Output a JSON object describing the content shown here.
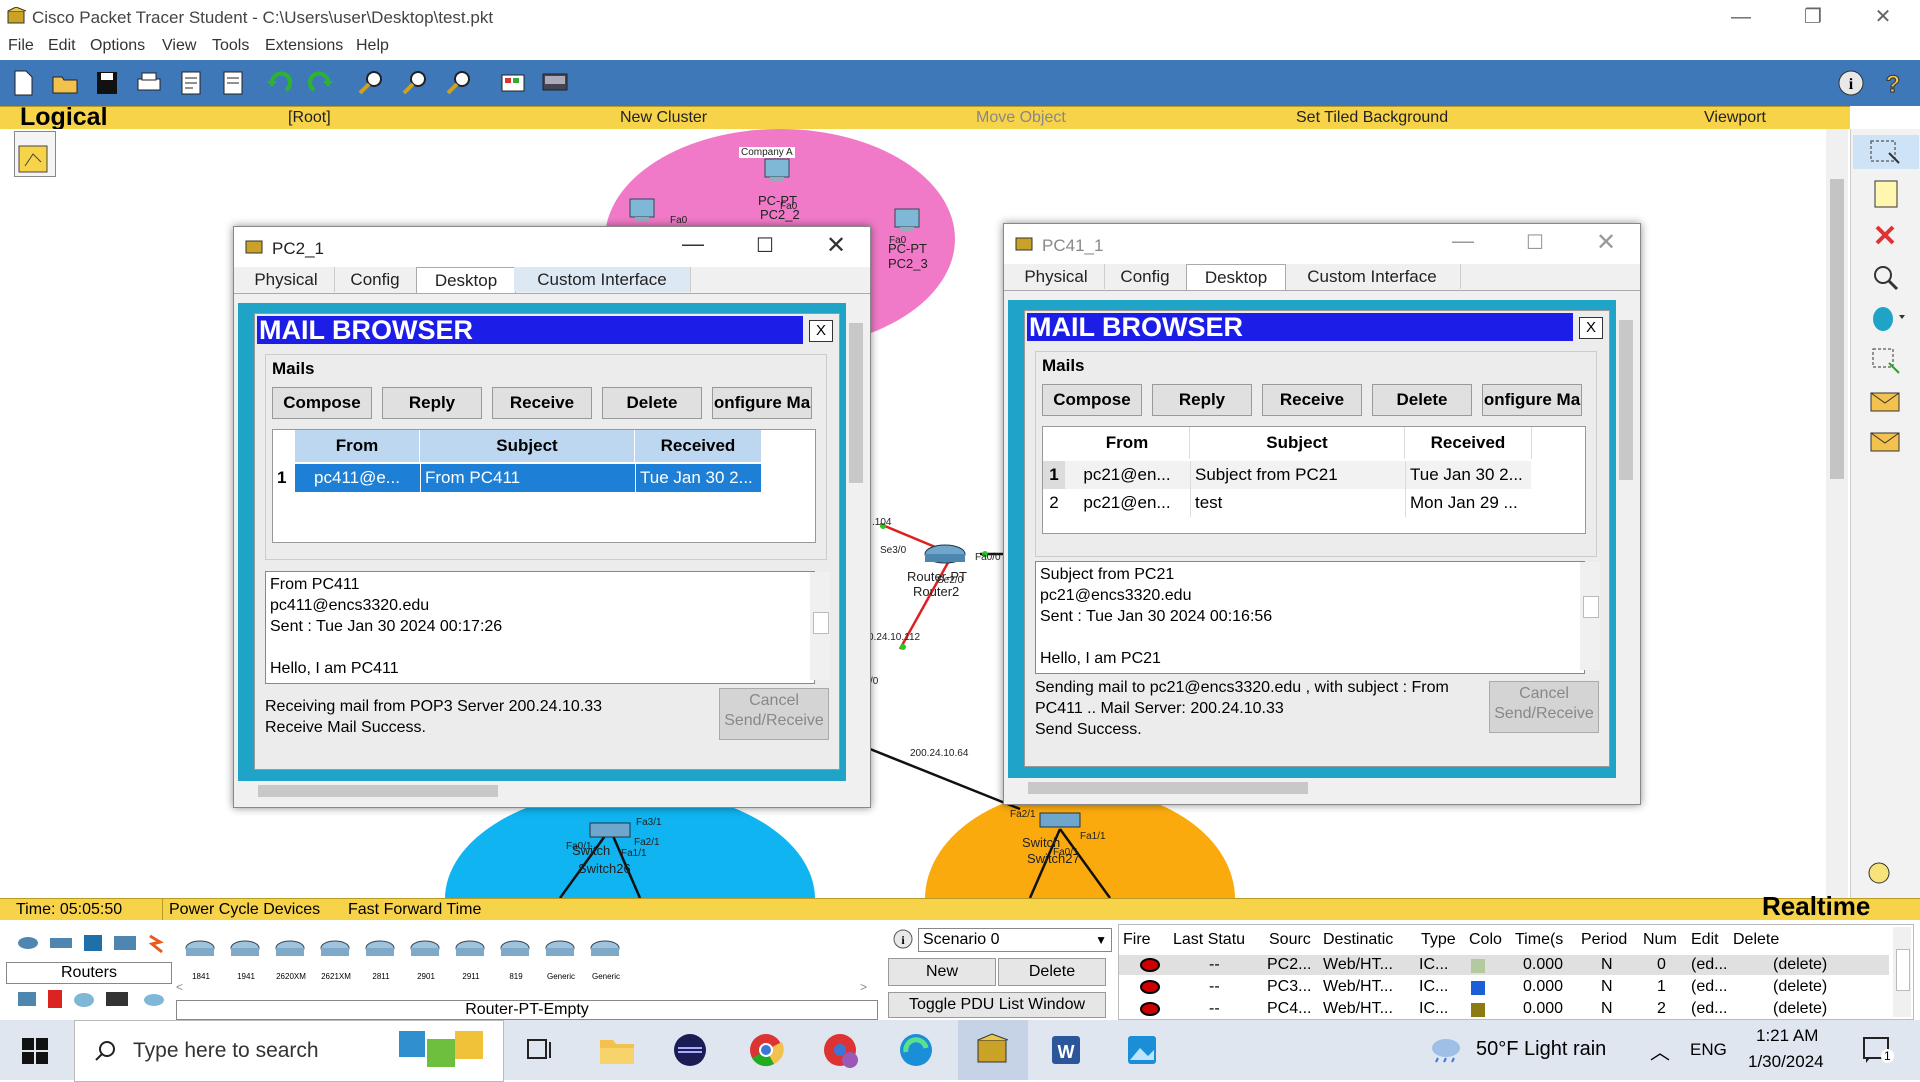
{
  "app": {
    "title": "Cisco Packet Tracer Student - C:\\Users\\user\\Desktop\\test.pkt",
    "menu": [
      "File",
      "Edit",
      "Options",
      "View",
      "Tools",
      "Extensions",
      "Help"
    ]
  },
  "workspace_bar": {
    "logical": "Logical",
    "root": "[Root]",
    "new_cluster": "New Cluster",
    "move_object": "Move Object",
    "set_tiled_bg": "Set Tiled Background",
    "viewport": "Viewport"
  },
  "network": {
    "labels": {
      "company_a": "Company A",
      "pc_pt_1": "PC-PT",
      "pc2_2": "PC2_2",
      "pc_pt_2": "PC-PT",
      "pc2_3": "PC2_3",
      "fa0_a": "Fa0",
      "fa0_b": "Fa0",
      "fa0_c": "Fa0",
      "ip_104": ".104",
      "se3_0": "Se3/0",
      "se2_0": "Se2/0",
      "fa0_0": "Fa0/0",
      "router_pt": "Router-PT",
      "router2": "Router2",
      "ip_112": "0.24.10.112",
      "slash0": "/0",
      "ip_64": "200.24.10.64",
      "fa3_1": "Fa3/1",
      "fa2_1_a": "Fa2/1",
      "fa1_1_a": "Fa1/1",
      "fa0_1_a": "Fa0/1",
      "switch26": "Switch26",
      "switch_a": "Switch",
      "fa2_1_b": "Fa2/1",
      "fa1_1_b": "Fa1/1",
      "fa0_1_b": "Fa0/1",
      "switch_b": "Switch",
      "switch27": "Switch27"
    }
  },
  "win1": {
    "title": "PC2_1",
    "tabs": [
      "Physical",
      "Config",
      "Desktop",
      "Custom Interface"
    ],
    "mail_title": "MAIL BROWSER",
    "close": "X",
    "mails_label": "Mails",
    "buttons": [
      "Compose",
      "Reply",
      "Receive",
      "Delete",
      "onfigure Ma"
    ],
    "columns": [
      "From",
      "Subject",
      "Received"
    ],
    "rows": [
      {
        "n": "1",
        "from": "pc411@e...",
        "subject": "From PC411",
        "received": "Tue Jan 30 2..."
      }
    ],
    "message": [
      "From PC411",
      "pc411@encs3320.edu",
      "Sent : Tue Jan 30 2024 00:17:26",
      "",
      "Hello, I am PC411"
    ],
    "status": [
      "Receiving mail from POP3 Server 200.24.10.33",
      "Receive Mail Success."
    ],
    "cancel": [
      "Cancel",
      "Send/Receive"
    ]
  },
  "win2": {
    "title": "PC41_1",
    "tabs": [
      "Physical",
      "Config",
      "Desktop",
      "Custom Interface"
    ],
    "mail_title": "MAIL BROWSER",
    "close": "X",
    "mails_label": "Mails",
    "buttons": [
      "Compose",
      "Reply",
      "Receive",
      "Delete",
      "onfigure Ma"
    ],
    "columns": [
      "From",
      "Subject",
      "Received"
    ],
    "rows": [
      {
        "n": "1",
        "from": "pc21@en...",
        "subject": "Subject from PC21",
        "received": "Tue Jan 30 2..."
      },
      {
        "n": "2",
        "from": "pc21@en...",
        "subject": "test",
        "received": "Mon Jan 29 ..."
      }
    ],
    "message": [
      "Subject from PC21",
      "pc21@encs3320.edu",
      "Sent : Tue Jan 30 2024 00:16:56",
      "",
      "Hello, I am PC21"
    ],
    "status": [
      "Sending mail to pc21@encs3320.edu , with subject : From",
      "PC411 ..   Mail Server: 200.24.10.33",
      "Send Success."
    ],
    "cancel": [
      "Cancel",
      "Send/Receive"
    ]
  },
  "timebar": {
    "time": "Time: 05:05:50",
    "power_cycle": "Power Cycle Devices",
    "fast_forward": "Fast Forward Time",
    "mode": "Realtime"
  },
  "device_panel": {
    "category": "Routers",
    "models": [
      "1841",
      "1941",
      "2620XM",
      "2621XM",
      "2811",
      "2901",
      "2911",
      "819",
      "Generic",
      "Generic"
    ],
    "selected_device": "Router-PT-Empty"
  },
  "scenario": {
    "value": "Scenario 0",
    "new": "New",
    "delete": "Delete",
    "toggle": "Toggle PDU List Window"
  },
  "pdu_table": {
    "columns": [
      "Fire",
      "Last Statu",
      "Sourc",
      "Destinatic",
      "Type",
      "Colo",
      "Time(s",
      "Period",
      "Num",
      "Edit",
      "Delete"
    ],
    "rows": [
      {
        "last": "--",
        "source": "PC2...",
        "dest": "Web/HT...",
        "type": "IC...",
        "color": "#b5c9a0",
        "time": "0.000",
        "periodic": "N",
        "num": "0",
        "edit": "(ed...",
        "delete": "(delete)"
      },
      {
        "last": "--",
        "source": "PC3...",
        "dest": "Web/HT...",
        "type": "IC...",
        "color": "#1a5fd6",
        "time": "0.000",
        "periodic": "N",
        "num": "1",
        "edit": "(ed...",
        "delete": "(delete)"
      },
      {
        "last": "--",
        "source": "PC4...",
        "dest": "Web/HT...",
        "type": "IC...",
        "color": "#8c7a12",
        "time": "0.000",
        "periodic": "N",
        "num": "2",
        "edit": "(ed...",
        "delete": "(delete)"
      }
    ]
  },
  "taskbar": {
    "search_placeholder": "Type here to search",
    "weather": "50°F  Light rain",
    "lang": "ENG",
    "time": "1:21 AM",
    "date": "1/30/2024",
    "notif_count": "1"
  }
}
